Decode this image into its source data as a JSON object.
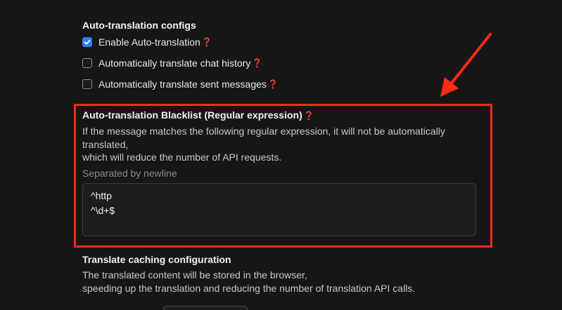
{
  "auto_translation": {
    "title": "Auto-translation configs",
    "options": [
      {
        "label": "Enable Auto-translation",
        "checked": true
      },
      {
        "label": "Automatically translate chat history",
        "checked": false
      },
      {
        "label": "Automatically translate sent messages",
        "checked": false
      }
    ]
  },
  "blacklist": {
    "title": "Auto-translation Blacklist (Regular expression)",
    "description_line1": "If the message matches the following regular expression, it will not be automatically",
    "description_line2": "translated,",
    "description_line3": "which will reduce the number of API requests.",
    "hint": "Separated by newline",
    "entries": [
      "^http",
      "^\\d+$"
    ]
  },
  "cache": {
    "title": "Translate caching configuration",
    "description_line1": "The translated content will be stored in the browser,",
    "description_line2": "speeding up the translation and reducing the number of translation API calls."
  },
  "icons": {
    "help": "❓",
    "check": "checkmark-icon"
  },
  "colors": {
    "accent": "#2f7df6",
    "highlight": "#ff2a14",
    "help_icon": "#d9443a",
    "background": "#161616"
  }
}
